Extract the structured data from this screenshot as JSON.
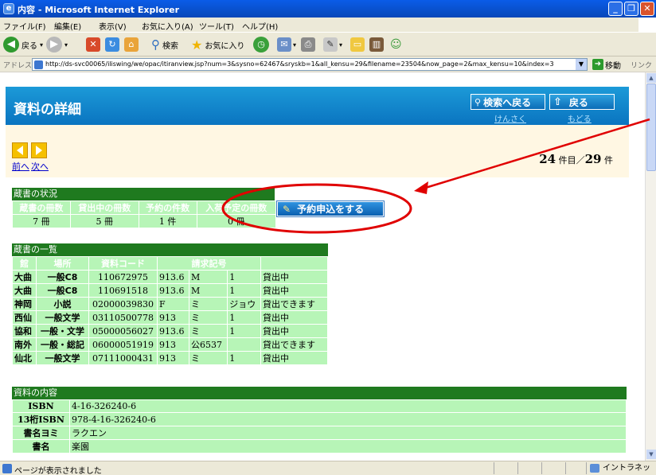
{
  "window": {
    "title": "内容 - Microsoft Internet Explorer"
  },
  "menu": [
    "ファイル(F)",
    "編集(E)",
    "表示(V)",
    "お気に入り(A)",
    "ツール(T)",
    "ヘルプ(H)"
  ],
  "toolbar": {
    "back_label": "戻る",
    "search_label": "検索",
    "favorites_label": "お気に入り"
  },
  "address": {
    "label": "アドレス(D)",
    "url": "http://ds-svc00065/iliswing/we/opac/itiranview.jsp?num=3&sysno=62467&sryskb=1&all_kensu=29&filename=23504&now_page=2&max_kensu=10&index=3",
    "go_label": "移動",
    "links_label": "リンク"
  },
  "header": {
    "page_title": "資料の詳細",
    "search_back_label": "検索へ戻る",
    "search_back_sub": "けんさく",
    "back_label": "戻る",
    "back_sub": "もどる"
  },
  "nav": {
    "prev_label": "前へ",
    "next_label": "次へ",
    "current": "24",
    "current_unit": "件目／",
    "total": "29",
    "total_unit": "件"
  },
  "holdings_status": {
    "section_title": "蔵書の状況",
    "headers": [
      "蔵書の冊数",
      "貸出中の冊数",
      "予約の件数",
      "入荷予定の冊数"
    ],
    "values": [
      "7 冊",
      "5 冊",
      "1 件",
      "0 冊"
    ],
    "reserve_button": "予約申込をする"
  },
  "holdings_list": {
    "section_title": "蔵書の一覧",
    "headers": [
      "館",
      "場所",
      "資料コード",
      "請求記号"
    ],
    "rows": [
      [
        "大曲",
        "一般C8",
        "110672975",
        "913.6",
        "M",
        "1",
        "貸出中"
      ],
      [
        "大曲",
        "一般C8",
        "110691518",
        "913.6",
        "M",
        "1",
        "貸出中"
      ],
      [
        "神岡",
        "小説",
        "02000039830",
        "F",
        "ミ",
        "ジョウ",
        "貸出できます"
      ],
      [
        "西仙",
        "一般文学",
        "03110500778",
        "913",
        "ミ",
        "1",
        "貸出中"
      ],
      [
        "協和",
        "一般・文学",
        "05000056027",
        "913.6",
        "ミ",
        "1",
        "貸出中"
      ],
      [
        "南外",
        "一般・総記",
        "06000051919",
        "913",
        "公6537",
        "",
        "貸出できます"
      ],
      [
        "仙北",
        "一般文学",
        "07111000431",
        "913",
        "ミ",
        "1",
        "貸出中"
      ]
    ]
  },
  "contents": {
    "section_title": "資料の内容",
    "rows": [
      [
        "ISBN",
        "4-16-326240-6"
      ],
      [
        "13桁ISBN",
        "978-4-16-326240-6"
      ],
      [
        "書名ヨミ",
        "ラクエン"
      ],
      [
        "書名",
        "楽園"
      ]
    ]
  },
  "status": {
    "text": "ページが表示されました",
    "zone": "イントラネット"
  },
  "colors": {
    "header_blue": "#0a74c0",
    "table_green": "#1f7a1f",
    "cell_green": "#b7f5b7",
    "annotation_red": "#e00000"
  }
}
